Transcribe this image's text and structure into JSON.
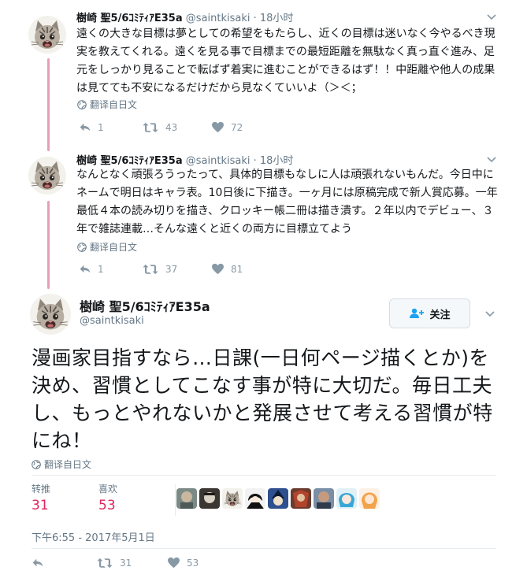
{
  "colors": {
    "thread_line": "#e6a0b6",
    "stat_number": "#e0245e",
    "icon_gray": "#8899a6",
    "follow_blue": "#1da1f2"
  },
  "tweets": [
    {
      "name": "樹崎 聖5/6ｺﾐﾃｨｱE35a",
      "handle": "@saintkisaki",
      "time": "· 18小时",
      "text": "遠くの大きな目標は夢としての希望をもたらし、近くの目標は迷いなく今やるべき現実を教えてくれる。遠くを見る事で目標までの最短距離を無駄なく真っ直ぐ進み、足元をしっかり見ることで転ばず着実に進むことができるはず！！中距離や他人の成果は見てても不安になるだけだから見なくていいよ（＞＜；",
      "translate": "翻译自日文",
      "replies": "1",
      "retweets": "43",
      "likes": "72"
    },
    {
      "name": "樹崎 聖5/6ｺﾐﾃｨｱE35a",
      "handle": "@saintkisaki",
      "time": "· 18小时",
      "text": "なんとなく頑張ろうったって、具体的目標もなしに人は頑張れないもんだ。今日中にネームで明日はキャラ表。10日後に下描き。一ヶ月には原稿完成で新人賞応募。一年最低４本の読み切りを描き、クロッキー帳二冊は描き潰す。２年以内でデビュー、３年で雑誌連載…そんな遠くと近くの両方に目標立てよう",
      "translate": "翻译自日文",
      "replies": "1",
      "retweets": "37",
      "likes": "81"
    }
  ],
  "main": {
    "name": "樹崎 聖5/6ｺﾐﾃｨｱE35a",
    "handle": "@saintkisaki",
    "follow_label": "关注",
    "text": "漫画家目指すなら…日課(一日何ページ描くとか)を決め、習慣としてこなす事が特に大切だ。毎日工夫し、もっとやれないかと発展させて考える習慣が特にね！",
    "translate": "翻译自日文",
    "retweet_label": "转推",
    "retweet_count": "31",
    "like_label": "喜欢",
    "like_count": "53",
    "date": "下午6:55 - 2017年5月1日",
    "action_retweets": "31",
    "action_likes": "53",
    "likers": [
      "liker-1",
      "liker-2",
      "liker-3",
      "liker-4",
      "liker-5",
      "liker-6",
      "liker-7",
      "liker-8",
      "liker-9"
    ]
  }
}
